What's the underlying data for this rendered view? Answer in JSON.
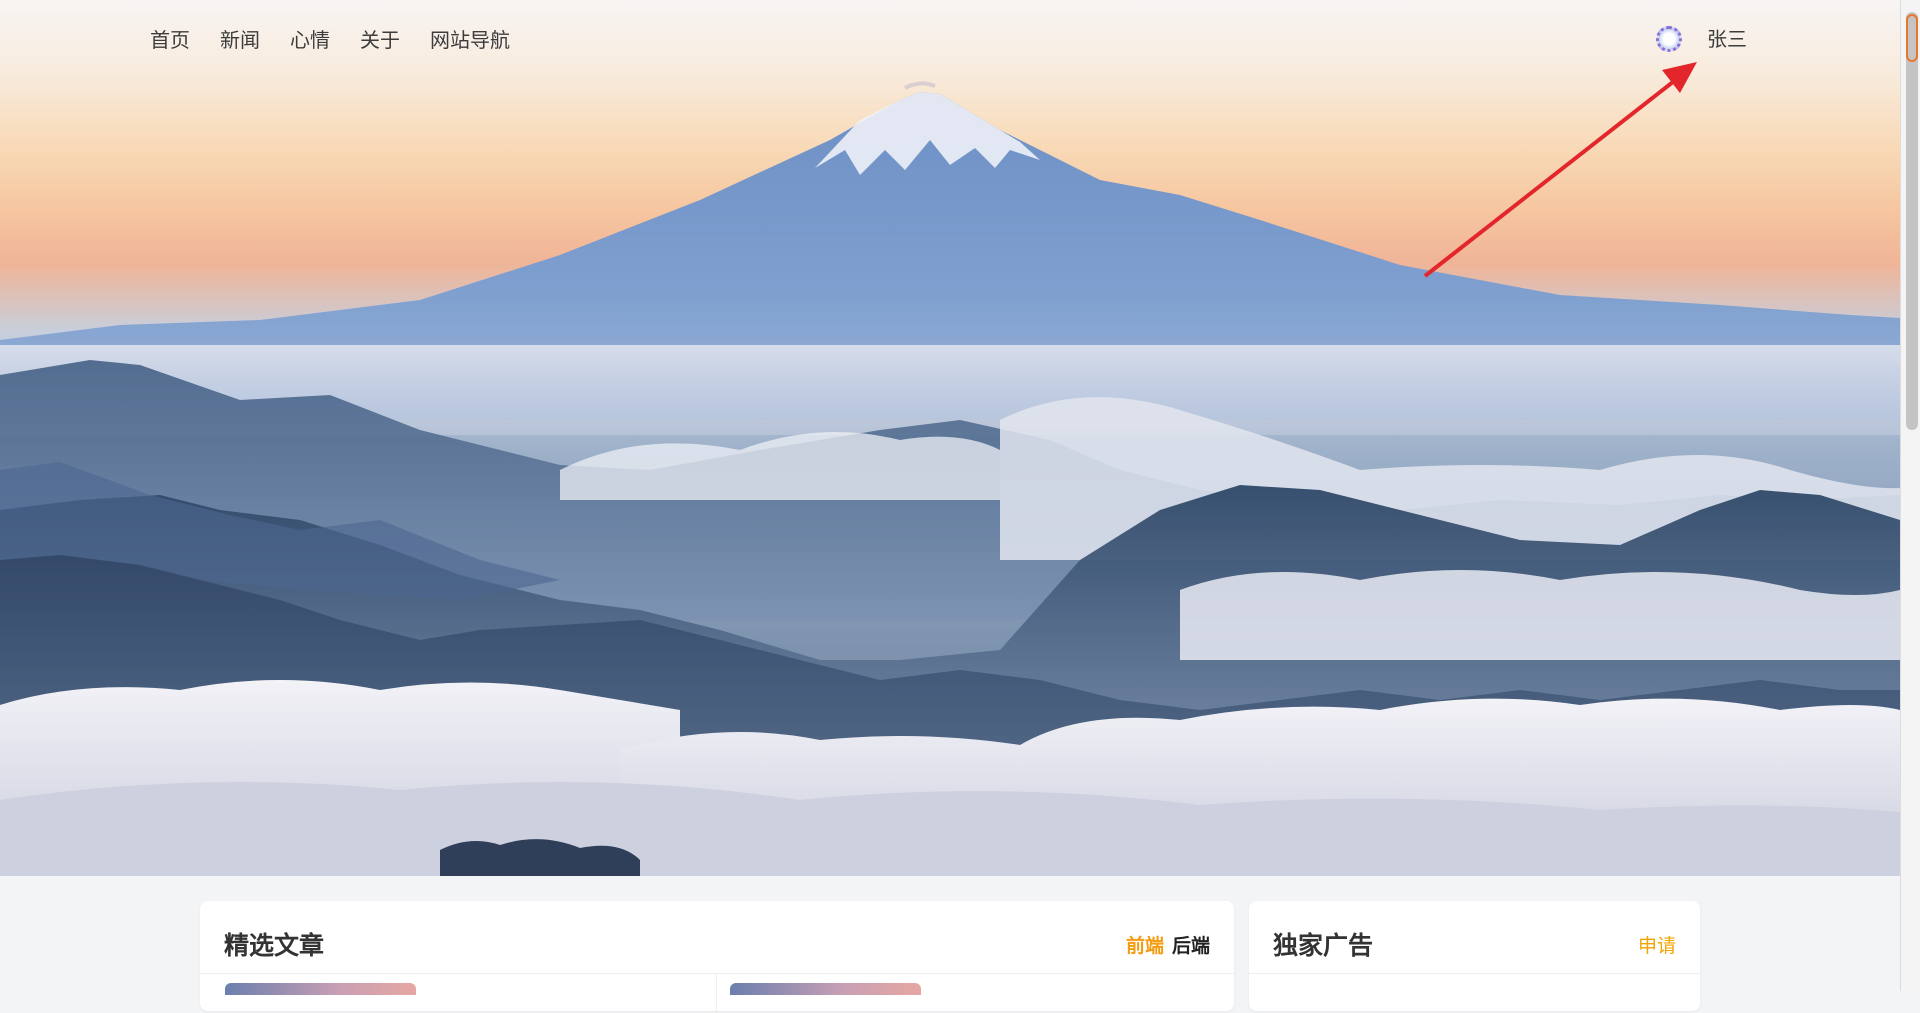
{
  "nav": {
    "items": [
      {
        "label": "首页"
      },
      {
        "label": "新闻"
      },
      {
        "label": "心情"
      },
      {
        "label": "关于"
      },
      {
        "label": "网站导航"
      }
    ]
  },
  "user": {
    "name": "张三",
    "avatar_icon": "avatar-ring-icon"
  },
  "annotation": {
    "arrow_color": "#e3262b"
  },
  "featured": {
    "title": "精选文章",
    "tabs": [
      {
        "label": "前端",
        "active": true
      },
      {
        "label": "后端",
        "active": false
      }
    ]
  },
  "ads": {
    "title": "独家广告",
    "apply_label": "申请"
  },
  "colors": {
    "accent": "#f39c12",
    "link": "#f0a500",
    "text": "#3c3c3c"
  }
}
